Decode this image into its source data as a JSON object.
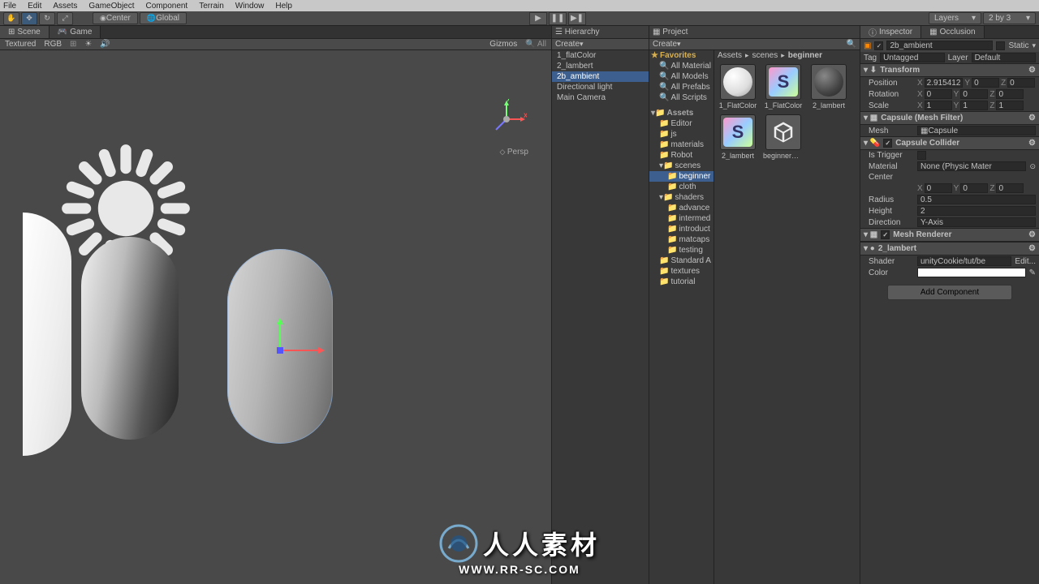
{
  "menu": [
    "File",
    "Edit",
    "Assets",
    "GameObject",
    "Component",
    "Terrain",
    "Window",
    "Help"
  ],
  "toolbar": {
    "center": "Center",
    "global": "Global",
    "layers": "Layers",
    "layout": "2 by 3"
  },
  "scene": {
    "tab_scene": "Scene",
    "tab_game": "Game",
    "shading": "Textured",
    "render_mode": "RGB",
    "gizmos": "Gizmos",
    "persp": "Persp"
  },
  "hierarchy": {
    "title": "Hierarchy",
    "create": "Create",
    "items": [
      "1_flatColor",
      "2_lambert",
      "2b_ambient",
      "Directional light",
      "Main Camera"
    ],
    "selected": "2b_ambient"
  },
  "project": {
    "title": "Project",
    "create": "Create",
    "favorites": "Favorites",
    "fav_items": [
      "All Material",
      "All Models",
      "All Prefabs",
      "All Scripts"
    ],
    "assets": "Assets",
    "folders": [
      "Editor",
      "js",
      "materials",
      "Robot",
      "scenes",
      "beginner",
      "cloth",
      "shaders",
      "advance",
      "intermed",
      "introduct",
      "matcaps",
      "testing",
      "Standard A",
      "textures",
      "tutorial"
    ],
    "breadcrumb": [
      "Assets",
      "scenes",
      "beginner"
    ],
    "asset_items": [
      "1_FlatColor",
      "1_FlatColor",
      "2_lambert",
      "2_lambert",
      "beginnerSc..."
    ]
  },
  "inspector": {
    "title": "Inspector",
    "occlusion": "Occlusion",
    "object_name": "2b_ambient",
    "static_label": "Static",
    "tag_label": "Tag",
    "tag_value": "Untagged",
    "layer_label": "Layer",
    "layer_value": "Default",
    "transform": {
      "title": "Transform",
      "position": "Position",
      "pos": {
        "x": "2.915412",
        "y": "0",
        "z": "0"
      },
      "rotation": "Rotation",
      "rot": {
        "x": "0",
        "y": "0",
        "z": "0"
      },
      "scale": "Scale",
      "scl": {
        "x": "1",
        "y": "1",
        "z": "1"
      }
    },
    "mesh_filter": {
      "title": "Capsule (Mesh Filter)",
      "mesh_label": "Mesh",
      "mesh_value": "Capsule"
    },
    "collider": {
      "title": "Capsule Collider",
      "is_trigger": "Is Trigger",
      "material": "Material",
      "material_value": "None (Physic Mater",
      "center": "Center",
      "center_vals": {
        "x": "0",
        "y": "0",
        "z": "0"
      },
      "radius": "Radius",
      "radius_value": "0.5",
      "height": "Height",
      "height_value": "2",
      "direction": "Direction",
      "direction_value": "Y-Axis"
    },
    "renderer": {
      "title": "Mesh Renderer"
    },
    "material": {
      "name": "2_lambert",
      "shader_label": "Shader",
      "shader_value": "unityCookie/tut/be",
      "edit": "Edit...",
      "color_label": "Color"
    },
    "add_component": "Add Component"
  },
  "watermark": {
    "cn": "人人素材",
    "url": "WWW.RR-SC.COM"
  }
}
